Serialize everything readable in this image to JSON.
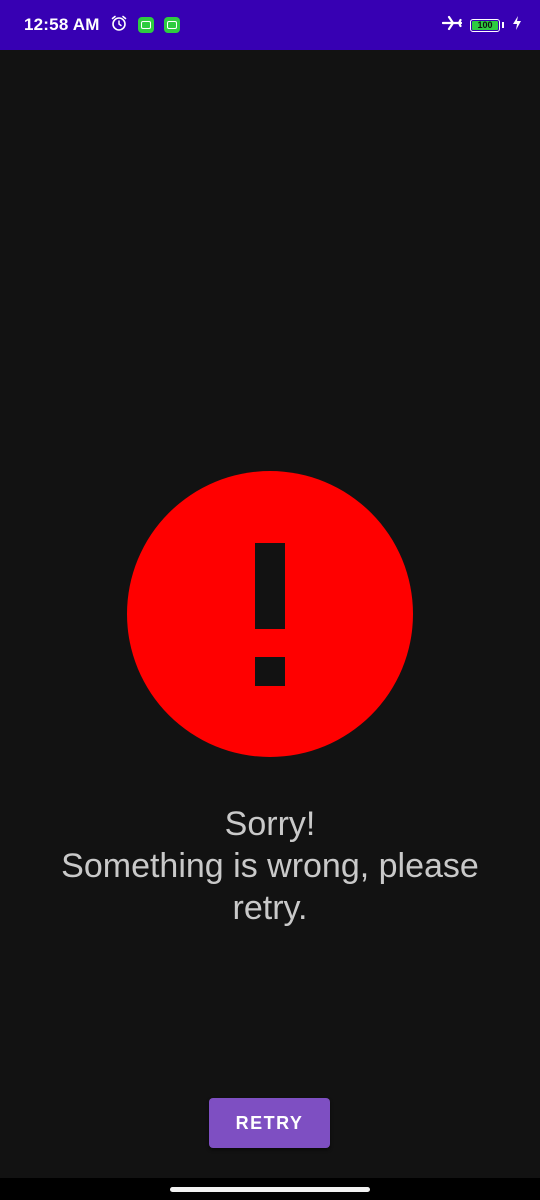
{
  "status_bar": {
    "time": "12:58 AM",
    "battery_level": "100",
    "icons": [
      "alarm-icon",
      "app-notification-icon",
      "app-notification-icon",
      "airplane-mode-icon",
      "battery-icon",
      "charging-icon"
    ]
  },
  "error": {
    "icon": "error-exclamation-icon",
    "icon_color": "#FF0000",
    "line1": "Sorry!",
    "line2": "Something is wrong, please",
    "line3": "retry."
  },
  "retry_button": {
    "label": "RETRY",
    "color": "#7E4FC2"
  },
  "colors": {
    "status_bar": "#3700B3",
    "background": "#121212",
    "message_text": "#C9C9C9"
  }
}
